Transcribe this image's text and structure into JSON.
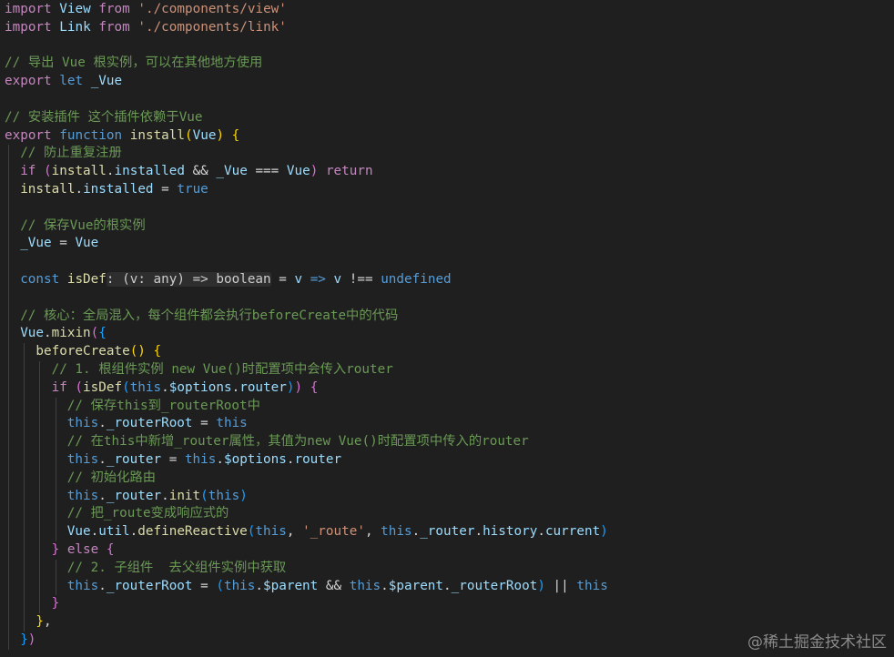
{
  "watermark": "@稀土掘金技术社区",
  "lines": [
    {
      "indent": 0,
      "tokens": [
        [
          "import",
          "k-ctrl"
        ],
        [
          " ",
          ""
        ],
        [
          "View",
          "v-var"
        ],
        [
          " ",
          ""
        ],
        [
          "from",
          "k-ctrl"
        ],
        [
          " ",
          ""
        ],
        [
          "'./components/view'",
          "v-str"
        ]
      ]
    },
    {
      "indent": 0,
      "tokens": [
        [
          "import",
          "k-ctrl"
        ],
        [
          " ",
          ""
        ],
        [
          "Link",
          "v-var"
        ],
        [
          " ",
          ""
        ],
        [
          "from",
          "k-ctrl"
        ],
        [
          " ",
          ""
        ],
        [
          "'./components/link'",
          "v-str"
        ]
      ]
    },
    {
      "indent": 0,
      "tokens": []
    },
    {
      "indent": 0,
      "tokens": [
        [
          "// 导出 Vue 根实例，可以在其他地方使用",
          "v-cmt"
        ]
      ]
    },
    {
      "indent": 0,
      "tokens": [
        [
          "export",
          "k-ctrl"
        ],
        [
          " ",
          ""
        ],
        [
          "let",
          "k-stor"
        ],
        [
          " ",
          ""
        ],
        [
          "_Vue",
          "v-var"
        ]
      ]
    },
    {
      "indent": 0,
      "tokens": []
    },
    {
      "indent": 0,
      "tokens": [
        [
          "// 安装插件 这个插件依赖于Vue",
          "v-cmt"
        ]
      ]
    },
    {
      "indent": 0,
      "tokens": [
        [
          "export",
          "k-ctrl"
        ],
        [
          " ",
          ""
        ],
        [
          "function",
          "k-stor"
        ],
        [
          " ",
          ""
        ],
        [
          "install",
          "v-fn"
        ],
        [
          "(",
          "v-br1"
        ],
        [
          "Vue",
          "v-var"
        ],
        [
          ")",
          "v-br1"
        ],
        [
          " ",
          ""
        ],
        [
          "{",
          "v-br1"
        ]
      ]
    },
    {
      "indent": 1,
      "tokens": [
        [
          "// 防止重复注册",
          "v-cmt"
        ]
      ]
    },
    {
      "indent": 1,
      "tokens": [
        [
          "if",
          "k-ctrl"
        ],
        [
          " ",
          ""
        ],
        [
          "(",
          "v-br2"
        ],
        [
          "install",
          "v-fn"
        ],
        [
          ".",
          "v-pun"
        ],
        [
          "installed",
          "v-var"
        ],
        [
          " && ",
          "v-op"
        ],
        [
          "_Vue",
          "v-var"
        ],
        [
          " === ",
          "v-op"
        ],
        [
          "Vue",
          "v-var"
        ],
        [
          ")",
          "v-br2"
        ],
        [
          " ",
          ""
        ],
        [
          "return",
          "k-ctrl"
        ]
      ]
    },
    {
      "indent": 1,
      "tokens": [
        [
          "install",
          "v-fn"
        ],
        [
          ".",
          "v-pun"
        ],
        [
          "installed",
          "v-var"
        ],
        [
          " = ",
          "v-op"
        ],
        [
          "true",
          "k-stor"
        ]
      ]
    },
    {
      "indent": 1,
      "tokens": []
    },
    {
      "indent": 1,
      "tokens": [
        [
          "// 保存Vue的根实例",
          "v-cmt"
        ]
      ]
    },
    {
      "indent": 1,
      "tokens": [
        [
          "_Vue",
          "v-var"
        ],
        [
          " = ",
          "v-op"
        ],
        [
          "Vue",
          "v-var"
        ]
      ]
    },
    {
      "indent": 1,
      "tokens": []
    },
    {
      "indent": 1,
      "tokens": [
        [
          "const",
          "k-stor"
        ],
        [
          " ",
          ""
        ],
        [
          "isDef",
          "v-fn"
        ],
        [
          ": (v: any) => boolean",
          "v-hint"
        ],
        [
          " = ",
          "v-op"
        ],
        [
          "v",
          "v-var"
        ],
        [
          " ",
          ""
        ],
        [
          "=>",
          "k-stor"
        ],
        [
          " ",
          ""
        ],
        [
          "v",
          "v-var"
        ],
        [
          " !== ",
          "v-op"
        ],
        [
          "undefined",
          "k-stor"
        ]
      ]
    },
    {
      "indent": 1,
      "tokens": []
    },
    {
      "indent": 1,
      "tokens": [
        [
          "// 核心：全局混入，每个组件都会执行beforeCreate中的代码",
          "v-cmt"
        ]
      ]
    },
    {
      "indent": 1,
      "tokens": [
        [
          "Vue",
          "v-var"
        ],
        [
          ".",
          "v-pun"
        ],
        [
          "mixin",
          "v-fn"
        ],
        [
          "(",
          "v-br2"
        ],
        [
          "{",
          "v-br3"
        ]
      ]
    },
    {
      "indent": 2,
      "tokens": [
        [
          "beforeCreate",
          "v-fn"
        ],
        [
          "()",
          "v-br1"
        ],
        [
          " ",
          ""
        ],
        [
          "{",
          "v-br1"
        ]
      ]
    },
    {
      "indent": 3,
      "tokens": [
        [
          "// 1. 根组件实例 new Vue()时配置项中会传入router",
          "v-cmt"
        ]
      ]
    },
    {
      "indent": 3,
      "tokens": [
        [
          "if",
          "k-ctrl"
        ],
        [
          " ",
          ""
        ],
        [
          "(",
          "v-br2"
        ],
        [
          "isDef",
          "v-fn"
        ],
        [
          "(",
          "v-br3"
        ],
        [
          "this",
          "k-stor"
        ],
        [
          ".",
          "v-pun"
        ],
        [
          "$options",
          "v-var"
        ],
        [
          ".",
          "v-pun"
        ],
        [
          "router",
          "v-var"
        ],
        [
          ")",
          "v-br3"
        ],
        [
          ")",
          "v-br2"
        ],
        [
          " ",
          ""
        ],
        [
          "{",
          "v-br2"
        ]
      ]
    },
    {
      "indent": 4,
      "tokens": [
        [
          "// 保存this到_routerRoot中",
          "v-cmt"
        ]
      ]
    },
    {
      "indent": 4,
      "tokens": [
        [
          "this",
          "k-stor"
        ],
        [
          ".",
          "v-pun"
        ],
        [
          "_routerRoot",
          "v-var"
        ],
        [
          " = ",
          "v-op"
        ],
        [
          "this",
          "k-stor"
        ]
      ]
    },
    {
      "indent": 4,
      "tokens": [
        [
          "// 在this中新增_router属性，其值为new Vue()时配置项中传入的router",
          "v-cmt"
        ]
      ]
    },
    {
      "indent": 4,
      "tokens": [
        [
          "this",
          "k-stor"
        ],
        [
          ".",
          "v-pun"
        ],
        [
          "_router",
          "v-var"
        ],
        [
          " = ",
          "v-op"
        ],
        [
          "this",
          "k-stor"
        ],
        [
          ".",
          "v-pun"
        ],
        [
          "$options",
          "v-var"
        ],
        [
          ".",
          "v-pun"
        ],
        [
          "router",
          "v-var"
        ]
      ]
    },
    {
      "indent": 4,
      "tokens": [
        [
          "// 初始化路由",
          "v-cmt"
        ]
      ]
    },
    {
      "indent": 4,
      "tokens": [
        [
          "this",
          "k-stor"
        ],
        [
          ".",
          "v-pun"
        ],
        [
          "_router",
          "v-var"
        ],
        [
          ".",
          "v-pun"
        ],
        [
          "init",
          "v-fn"
        ],
        [
          "(",
          "v-br3"
        ],
        [
          "this",
          "k-stor"
        ],
        [
          ")",
          "v-br3"
        ]
      ]
    },
    {
      "indent": 4,
      "tokens": [
        [
          "// 把_route变成响应式的",
          "v-cmt"
        ]
      ]
    },
    {
      "indent": 4,
      "tokens": [
        [
          "Vue",
          "v-var"
        ],
        [
          ".",
          "v-pun"
        ],
        [
          "util",
          "v-var"
        ],
        [
          ".",
          "v-pun"
        ],
        [
          "defineReactive",
          "v-fn"
        ],
        [
          "(",
          "v-br3"
        ],
        [
          "this",
          "k-stor"
        ],
        [
          ", ",
          "v-pun"
        ],
        [
          "'_route'",
          "v-str"
        ],
        [
          ", ",
          "v-pun"
        ],
        [
          "this",
          "k-stor"
        ],
        [
          ".",
          "v-pun"
        ],
        [
          "_router",
          "v-var"
        ],
        [
          ".",
          "v-pun"
        ],
        [
          "history",
          "v-var"
        ],
        [
          ".",
          "v-pun"
        ],
        [
          "current",
          "v-var"
        ],
        [
          ")",
          "v-br3"
        ]
      ]
    },
    {
      "indent": 3,
      "tokens": [
        [
          "}",
          "v-br2"
        ],
        [
          " ",
          ""
        ],
        [
          "else",
          "k-ctrl"
        ],
        [
          " ",
          ""
        ],
        [
          "{",
          "v-br2"
        ]
      ]
    },
    {
      "indent": 4,
      "tokens": [
        [
          "// 2. 子组件  去父组件实例中获取",
          "v-cmt"
        ]
      ]
    },
    {
      "indent": 4,
      "tokens": [
        [
          "this",
          "k-stor"
        ],
        [
          ".",
          "v-pun"
        ],
        [
          "_routerRoot",
          "v-var"
        ],
        [
          " = ",
          "v-op"
        ],
        [
          "(",
          "v-br3"
        ],
        [
          "this",
          "k-stor"
        ],
        [
          ".",
          "v-pun"
        ],
        [
          "$parent",
          "v-var"
        ],
        [
          " && ",
          "v-op"
        ],
        [
          "this",
          "k-stor"
        ],
        [
          ".",
          "v-pun"
        ],
        [
          "$parent",
          "v-var"
        ],
        [
          ".",
          "v-pun"
        ],
        [
          "_routerRoot",
          "v-var"
        ],
        [
          ")",
          "v-br3"
        ],
        [
          " || ",
          "v-op"
        ],
        [
          "this",
          "k-stor"
        ]
      ]
    },
    {
      "indent": 3,
      "tokens": [
        [
          "}",
          "v-br2"
        ]
      ]
    },
    {
      "indent": 2,
      "tokens": [
        [
          "}",
          "v-br1"
        ],
        [
          ",",
          "v-pun"
        ]
      ]
    },
    {
      "indent": 1,
      "tokens": [
        [
          "}",
          "v-br3"
        ],
        [
          ")",
          "v-br2"
        ]
      ]
    }
  ]
}
